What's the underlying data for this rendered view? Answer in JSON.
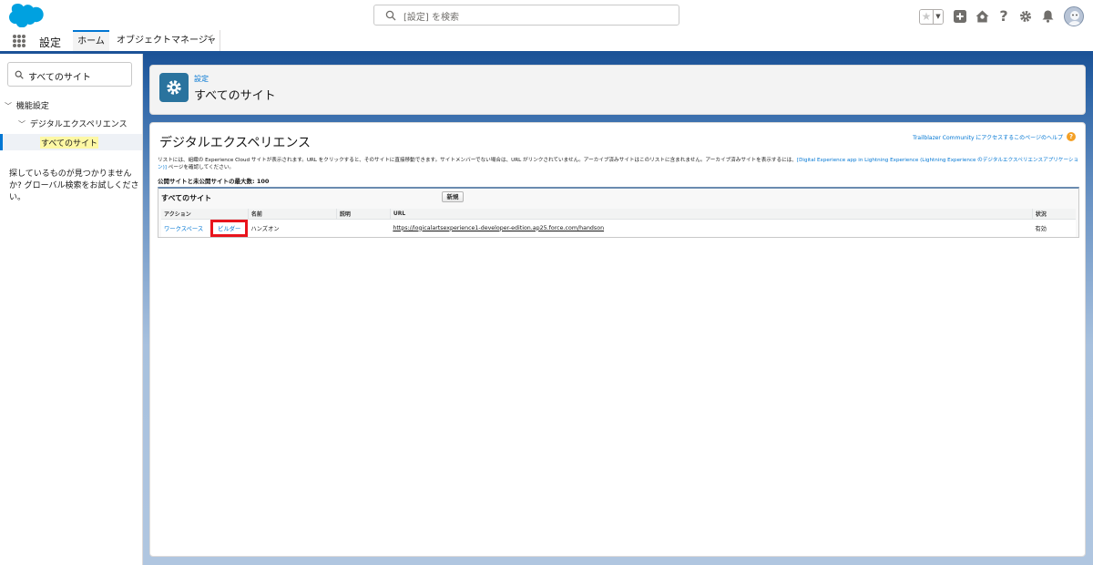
{
  "header": {
    "search_placeholder": "[設定] を検索"
  },
  "context_bar": {
    "app_name": "設定",
    "tabs": [
      {
        "label": "ホーム"
      },
      {
        "label": "オブジェクトマネージャ"
      }
    ]
  },
  "sidebar": {
    "quickfind_value": "すべてのサイト",
    "tree": {
      "level1": "機能設定",
      "level2": "デジタルエクスペリエンス",
      "level3": "すべてのサイト"
    },
    "not_found_text": "探しているものが見つかりませんか? グローバル検索をお試しください。"
  },
  "page_header": {
    "breadcrumb": "設定",
    "title": "すべてのサイト"
  },
  "content": {
    "title": "デジタルエクスペリエンス",
    "help_link": "Trailblazer Community にアクセスするこのページのヘルプ",
    "description_part1": "リストには、組織の Experience Cloud サイトが表示されます。URL をクリックすると、そのサイトに直接移動できます。サイトメンバーでない場合は、URL がリンクされていません。アーカイブ済みサイトはこのリストに含まれません。アーカイブ済みサイトを表示するには、",
    "description_link": "[Digital Experience app in Lightning Experience (Lightning Experience のデジタルエクスペリエンスアプリケーション)]",
    "description_part2": " ページを確認してください。",
    "max_sites": "公開サイトと未公開サイトの最大数: 100",
    "list": {
      "title": "すべてのサイト",
      "new_button": "新規",
      "columns": [
        "アクション",
        "名前",
        "説明",
        "URL",
        "状況"
      ],
      "rows": [
        {
          "action_workspace": "ワークスペース",
          "action_builder": "ビルダー",
          "name": "ハンズオン",
          "description": "",
          "url": "https://logicalartsexperience1-developer-edition.ap25.force.com/handson",
          "status": "有効"
        }
      ]
    }
  },
  "colors": {
    "brand_blue": "#0176d3",
    "header_band": "#1b5297",
    "highlight_red": "#e8141c",
    "setup_icon": "#2a739e"
  }
}
